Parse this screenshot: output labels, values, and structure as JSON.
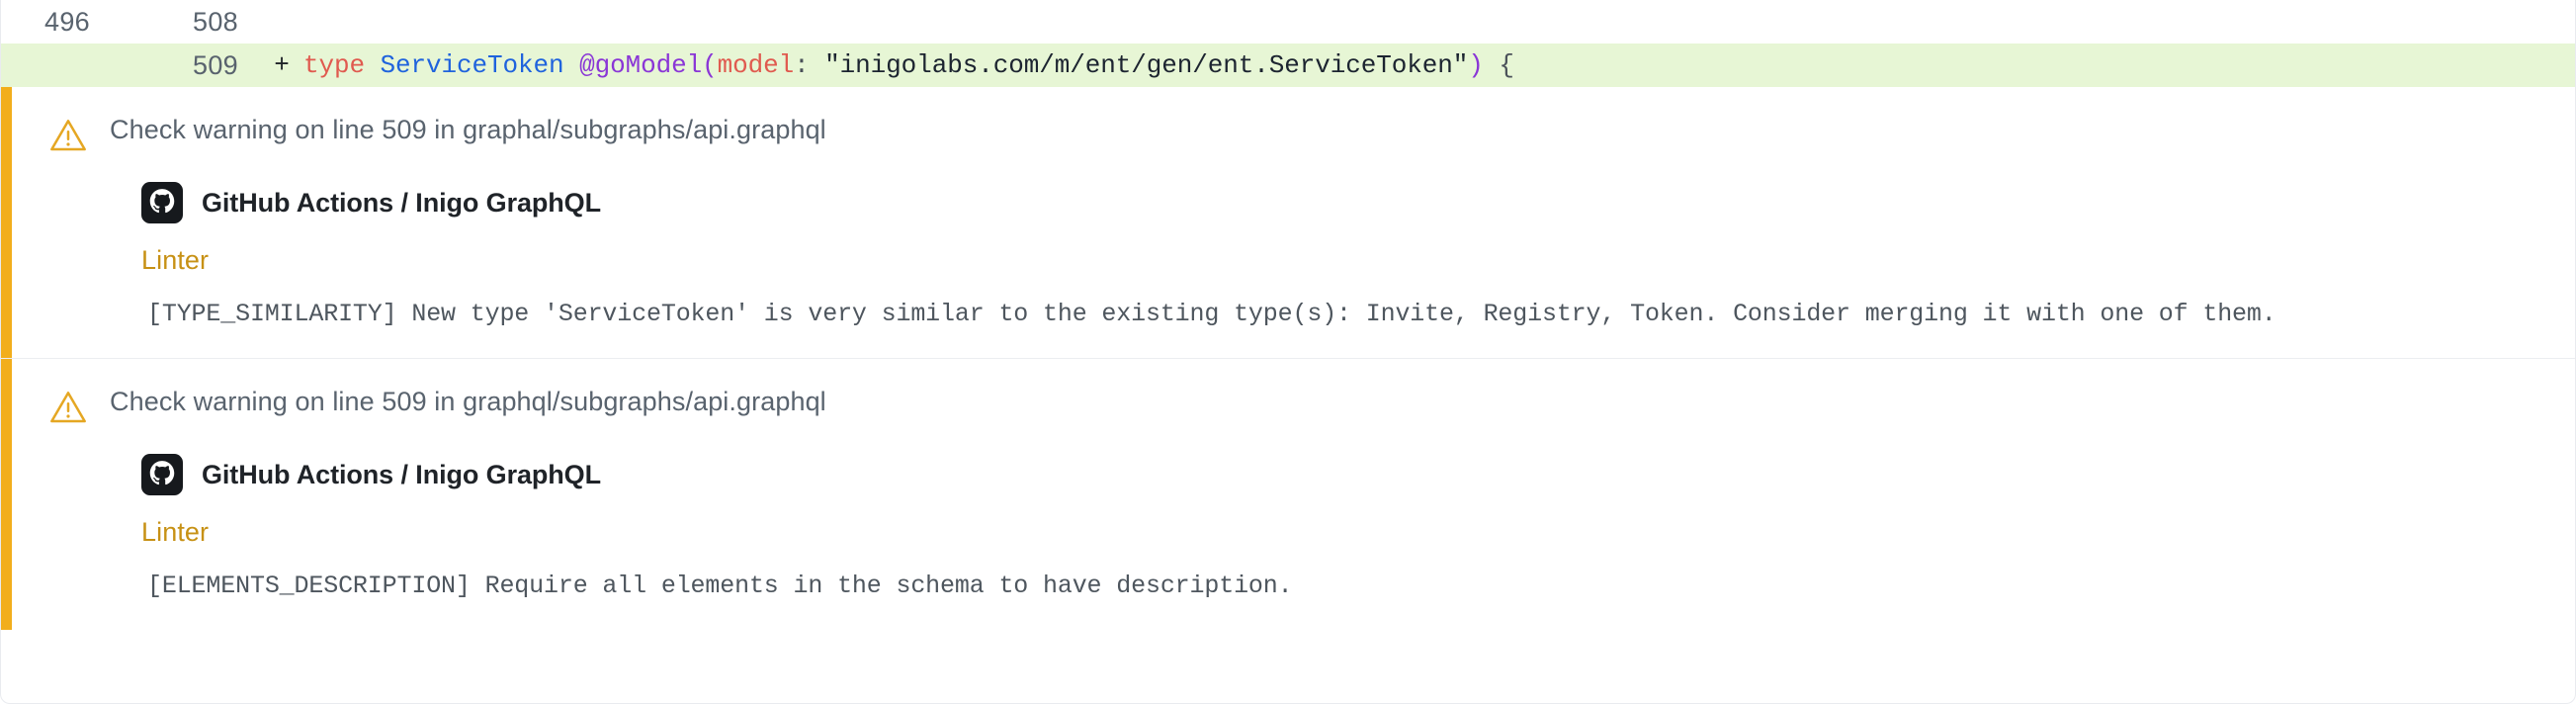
{
  "diff": {
    "context_row": {
      "old_line": "496",
      "new_line": "508",
      "marker": "",
      "code_plain": ""
    },
    "added_row": {
      "old_line": "",
      "new_line": "509",
      "marker": "+",
      "code_plain": "type ServiceToken @goModel(model: \"inigolabs.com/m/ent/gen/ent.ServiceToken\") {",
      "tokens": {
        "keyword": "type",
        "type_name": "ServiceToken",
        "directive": "@goModel",
        "paren_open": "(",
        "arg_name": "model",
        "colon": ":",
        "string_value": "\"inigolabs.com/m/ent/gen/ent.ServiceToken\"",
        "paren_close": ")",
        "brace_open": "{"
      }
    }
  },
  "annotations": [
    {
      "icon": "warning-triangle-icon",
      "headline": "Check warning on line 509 in graphal/subgraphs/api.graphql",
      "app_icon": "github-octocat-icon",
      "app_name": "GitHub Actions / Inigo GraphQL",
      "tool": "Linter",
      "message": "[TYPE_SIMILARITY] New type 'ServiceToken' is very similar to the existing type(s): Invite, Registry, Token. Consider merging it with one of them."
    },
    {
      "icon": "warning-triangle-icon",
      "headline": "Check warning on line 509 in graphql/subgraphs/api.graphql",
      "app_icon": "github-octocat-icon",
      "app_name": "GitHub Actions / Inigo GraphQL",
      "tool": "Linter",
      "message": "[ELEMENTS_DESCRIPTION] Require all elements in the schema to have description."
    }
  ],
  "colors": {
    "warning_bar": "#f2ae1c",
    "warning_icon": "#e5a723",
    "tool_label": "#c79115",
    "diff_add_bg": "#e7f6d5",
    "keyword": "#e05a4f",
    "type_name": "#1f63dd",
    "directive": "#8a36d6",
    "string": "#1c2430"
  }
}
